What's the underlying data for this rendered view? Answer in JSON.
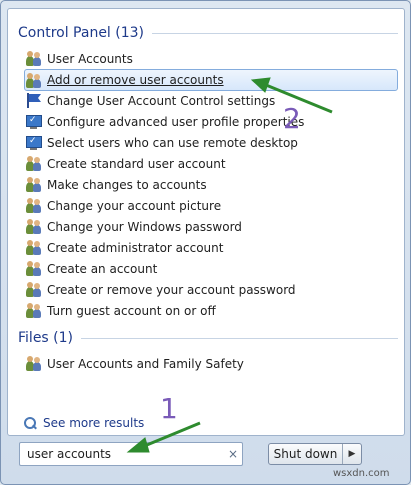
{
  "control_panel": {
    "heading": "Control Panel (13)",
    "items": [
      {
        "label": "User Accounts",
        "icon": "users-icon"
      },
      {
        "label": "Add or remove user accounts",
        "icon": "users-icon",
        "selected": true
      },
      {
        "label": "Change User Account Control settings",
        "icon": "flag-icon"
      },
      {
        "label": "Configure advanced user profile properties",
        "icon": "monitor-icon"
      },
      {
        "label": "Select users who can use remote desktop",
        "icon": "monitor-icon"
      },
      {
        "label": "Create standard user account",
        "icon": "users-icon"
      },
      {
        "label": "Make changes to accounts",
        "icon": "users-icon"
      },
      {
        "label": "Change your account picture",
        "icon": "users-icon"
      },
      {
        "label": "Change your Windows password",
        "icon": "users-icon"
      },
      {
        "label": "Create administrator account",
        "icon": "users-icon"
      },
      {
        "label": "Create an account",
        "icon": "users-icon"
      },
      {
        "label": "Create or remove your account password",
        "icon": "users-icon"
      },
      {
        "label": "Turn guest account on or off",
        "icon": "users-icon"
      }
    ]
  },
  "files": {
    "heading": "Files (1)",
    "items": [
      {
        "label": "User Accounts and Family Safety",
        "icon": "users-icon"
      }
    ]
  },
  "see_more": "See more results",
  "search": {
    "value": "user accounts",
    "clear": "×"
  },
  "shutdown": {
    "label": "Shut down",
    "arrow": "▶"
  },
  "annotations": {
    "step1": "1",
    "step2": "2",
    "arrow_color": "#2e8b2e"
  },
  "watermark": "wsxdn.com"
}
